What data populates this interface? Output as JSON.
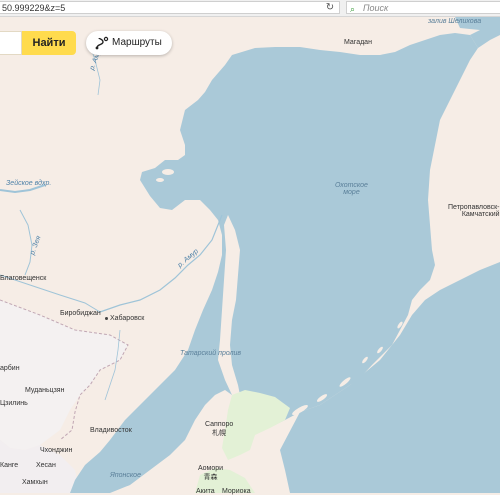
{
  "browser": {
    "url_fragment": "50.999229&z=5",
    "reload_icon": "reload-icon",
    "search_placeholder": "Поиск",
    "search_engine_icon": "yandex-search-icon"
  },
  "map_ui": {
    "find_button": "Найти",
    "routes_button": "Маршруты",
    "routes_icon": "route-icon"
  },
  "map": {
    "colors": {
      "water": "#aac9d8",
      "land": "#f6ede6",
      "forest": "#dde7d0",
      "hokkaido": "#e3f1d6",
      "china": "#f4f1f1",
      "border": "#c0a6b3"
    },
    "water_labels": {
      "okhotsk": "Охотское\nморе",
      "tatar_strait": "Татарский пролив",
      "shelikhov": "залив Шелихова",
      "japan_sea": "Японское"
    },
    "river_labels": {
      "amur": "р. Амур",
      "amur_top": "р. Амур",
      "zeya": "р. Зея",
      "zeya_res": "Зейское вдхр."
    },
    "cities": {
      "magadan": "Магадан",
      "petropavlovsk_1": "Петропавловск-",
      "petropavlovsk_2": "Камчатский",
      "blagoveshchensk": "Благовещенск",
      "birobidzhan": "Биробиджан",
      "khabarovsk": "Хабаровск",
      "harbin": "арбин",
      "vladivostok": "Владивосток",
      "sapporo_1": "Саппоро",
      "sapporo_2": "札幌",
      "aomori_1": "Аомори",
      "aomori_2": "青森",
      "akita": "Акита",
      "morioka": "Мориока",
      "chongjin": "Чхонджин",
      "hesan": "Хесан",
      "kange": "Канге",
      "hamhung": "Хамхын",
      "jilin": "Цзилинь",
      "mudanjiang": "Муданьцзян"
    }
  }
}
